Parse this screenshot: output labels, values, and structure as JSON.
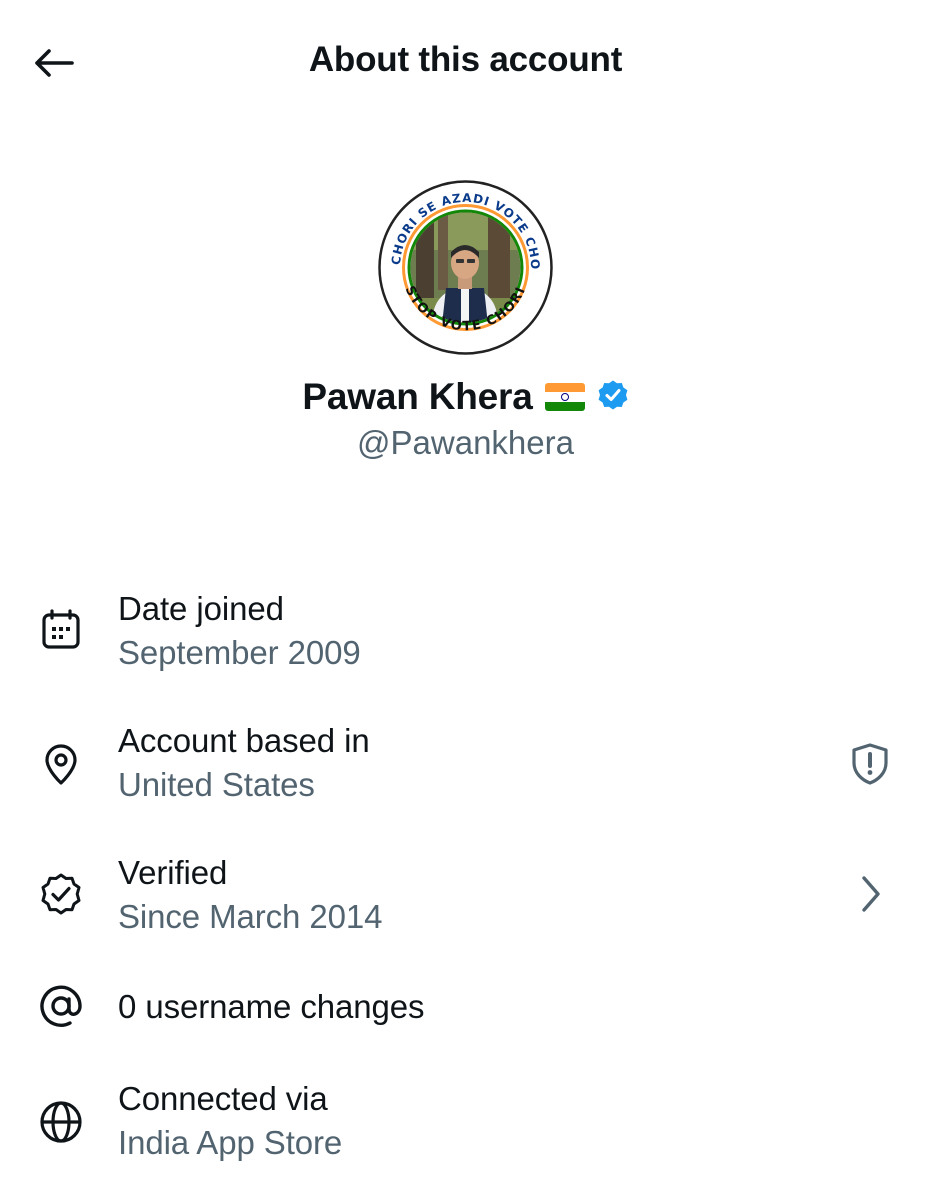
{
  "header": {
    "title": "About this account",
    "back_icon": "arrow-left-icon"
  },
  "profile": {
    "name": "Pawan Khera",
    "handle": "@Pawankhera",
    "flag_icon": "india-flag-icon",
    "verified_badge": "verified-badge-icon",
    "badge_color": "#1d9bf0",
    "avatar_ring_text_top": "VOTE CHORI SE AZADI VOTE CHORI SE",
    "avatar_ring_text_bottom": "STOP VOTE CHORI"
  },
  "details": [
    {
      "label": "Date joined",
      "value": "September 2009",
      "icon": "calendar-icon"
    },
    {
      "label": "Account based in",
      "value": "United States",
      "icon": "location-pin-icon",
      "action_icon": "shield-alert-icon"
    },
    {
      "label": "Verified",
      "value": "Since March 2014",
      "icon": "verified-check-icon",
      "action_icon": "chevron-right-icon"
    },
    {
      "label": "0 username changes",
      "icon": "at-sign-icon"
    },
    {
      "label": "Connected via",
      "value": "India App Store",
      "icon": "globe-icon"
    }
  ],
  "colors": {
    "text_primary": "#0f1419",
    "text_secondary": "#536471",
    "icon_secondary": "#536471"
  }
}
